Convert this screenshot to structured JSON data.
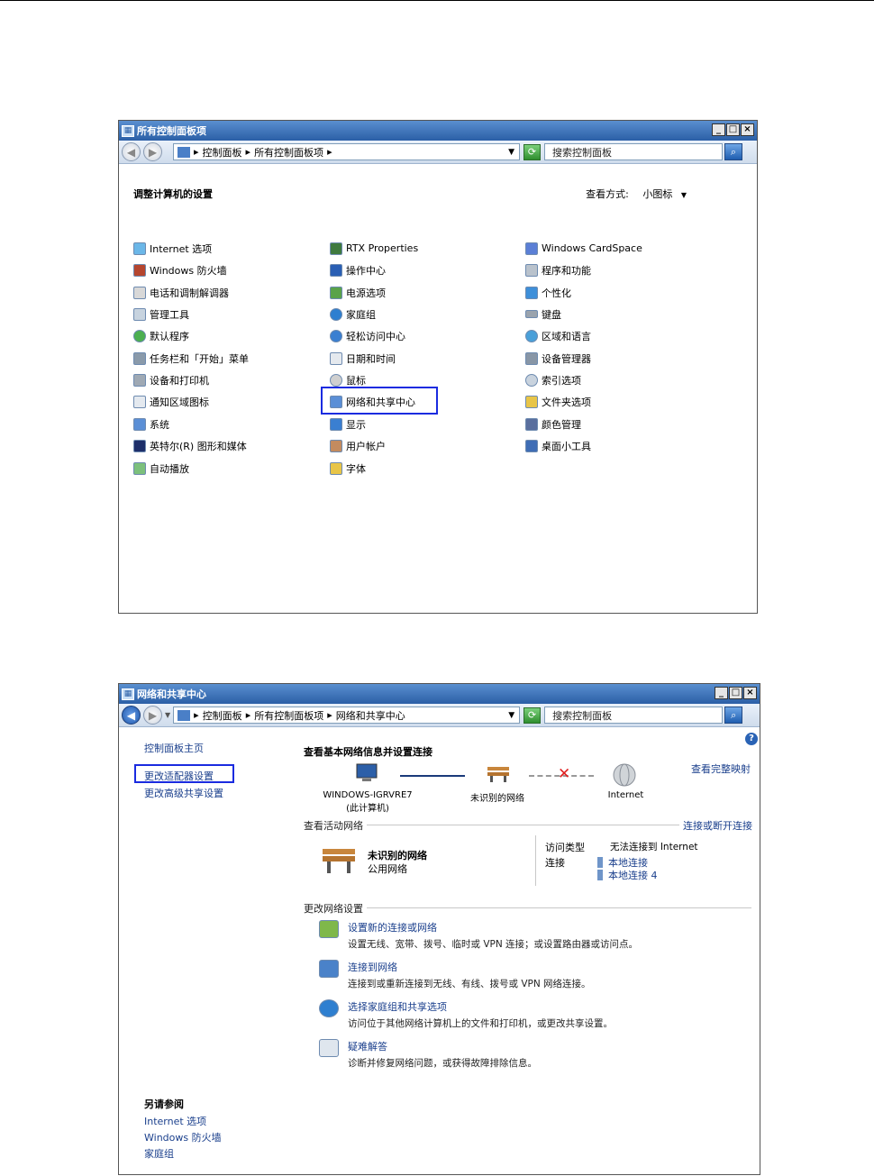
{
  "window1": {
    "title": "所有控制面板项",
    "address": [
      "控制面板",
      "所有控制面板项"
    ],
    "search_placeholder": "搜索控制面板",
    "heading": "调整计算机的设置",
    "view_label": "查看方式:",
    "view_value": "小图标",
    "columns": [
      [
        "Internet 选项",
        "Windows 防火墙",
        "电话和调制解调器",
        "管理工具",
        "默认程序",
        "任务栏和「开始」菜单",
        "设备和打印机",
        "通知区域图标",
        "系统",
        "英特尔(R) 图形和媒体",
        "自动播放"
      ],
      [
        "RTX Properties",
        "操作中心",
        "电源选项",
        "家庭组",
        "轻松访问中心",
        "日期和时间",
        "鼠标",
        "网络和共享中心",
        "显示",
        "用户帐户",
        "字体"
      ],
      [
        "Windows CardSpace",
        "程序和功能",
        "个性化",
        "键盘",
        "区域和语言",
        "设备管理器",
        "索引选项",
        "文件夹选项",
        "颜色管理",
        "桌面小工具"
      ]
    ]
  },
  "window2": {
    "title": "网络和共享中心",
    "address": [
      "控制面板",
      "所有控制面板项",
      "网络和共享中心"
    ],
    "search_placeholder": "搜索控制面板",
    "sidebar": {
      "home": "控制面板主页",
      "links": [
        "更改适配器设置",
        "更改高级共享设置"
      ],
      "see_also_title": "另请参阅",
      "see_also": [
        "Internet 选项",
        "Windows 防火墙",
        "家庭组"
      ]
    },
    "heading": "查看基本网络信息并设置连接",
    "full_map": "查看完整映射",
    "map": {
      "computer": "WINDOWS-IGRVRE7",
      "computer_sub": "(此计算机)",
      "network": "未识别的网络",
      "internet": "Internet"
    },
    "active_title": "查看活动网络",
    "active_link": "连接或断开连接",
    "active_network": {
      "name": "未识别的网络",
      "type": "公用网络",
      "access_label": "访问类型",
      "access_value": "无法连接到 Internet",
      "conn_label": "连接",
      "connections": [
        "本地连接",
        "本地连接 4"
      ]
    },
    "change_title": "更改网络设置",
    "tasks": [
      {
        "title": "设置新的连接或网络",
        "desc": "设置无线、宽带、拨号、临时或 VPN 连接；或设置路由器或访问点。",
        "icon": "new-connection-icon"
      },
      {
        "title": "连接到网络",
        "desc": "连接到或重新连接到无线、有线、拨号或 VPN 网络连接。",
        "icon": "connect-network-icon"
      },
      {
        "title": "选择家庭组和共享选项",
        "desc": "访问位于其他网络计算机上的文件和打印机，或更改共享设置。",
        "icon": "homegroup-icon"
      },
      {
        "title": "疑难解答",
        "desc": "诊断并修复网络问题，或获得故障排除信息。",
        "icon": "troubleshoot-icon"
      }
    ]
  }
}
